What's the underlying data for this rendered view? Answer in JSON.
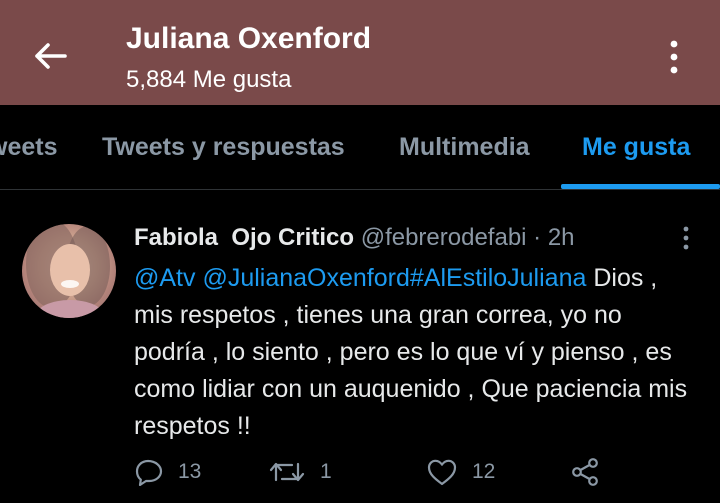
{
  "header": {
    "title": "Juliana Oxenford",
    "subtitle": "5,884 Me gusta",
    "color": "#7a4a4a",
    "back_icon": "arrow-left-icon",
    "more_icon": "more-vertical-icon"
  },
  "tabs": [
    {
      "label": "weets"
    },
    {
      "label": "Tweets y respuestas"
    },
    {
      "label": "Multimedia"
    },
    {
      "label": "Me gusta",
      "active": true
    }
  ],
  "accent_color": "#1d9bf0",
  "tweet": {
    "name": "Fabiola  Ojo Critico",
    "handle": "@febrerodefabi · 2h",
    "mention1": "@Atv",
    "mention2": "@JulianaOxenford",
    "hashtag": "#AlEstiloJuliana",
    "text": "Dios , mis respetos , tienes una gran correa, yo no podría , lo siento , pero es lo que ví y pienso , es como lidiar con un auquenido , Que paciencia mis respetos !!",
    "actions": {
      "replies": "13",
      "retweets": "1",
      "likes": "12"
    }
  }
}
